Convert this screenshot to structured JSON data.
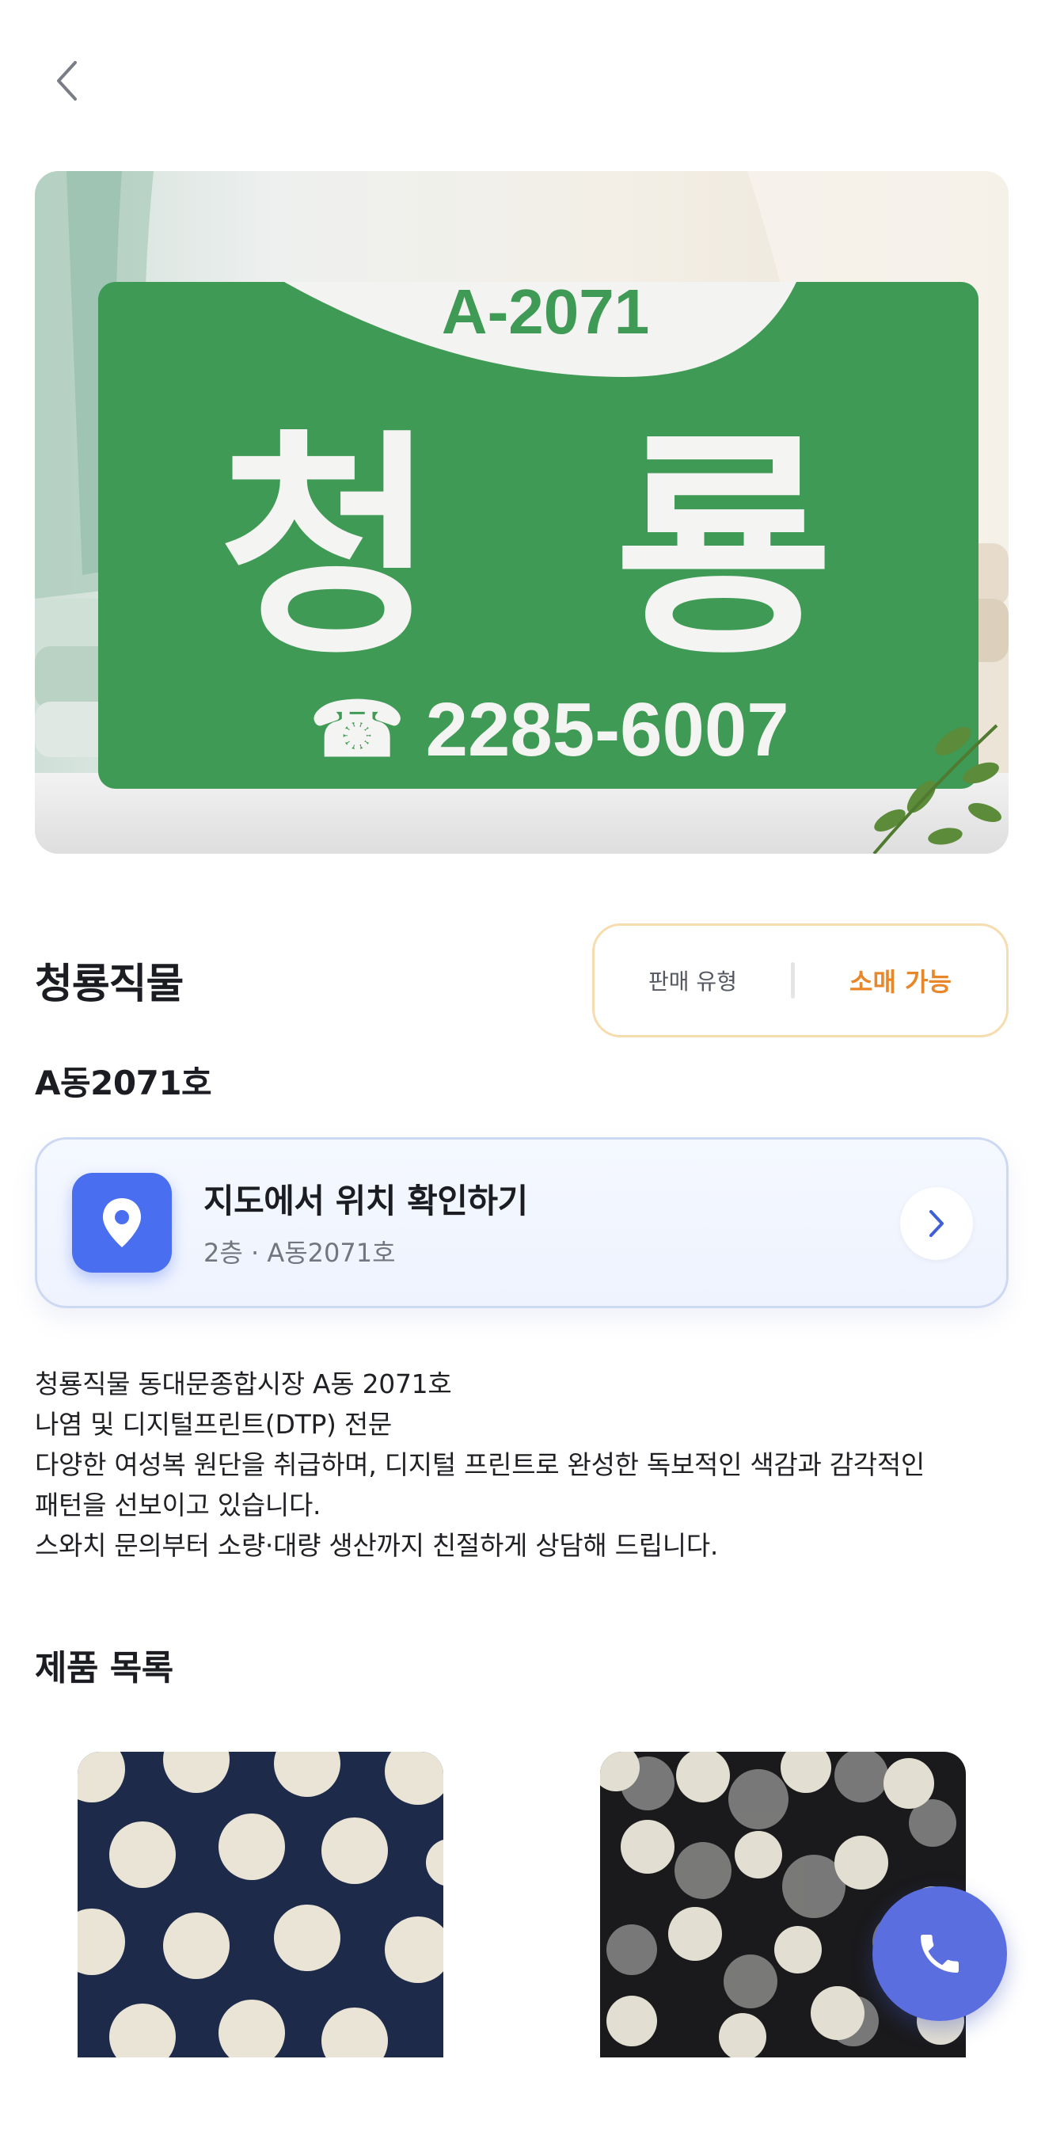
{
  "header": {
    "back_icon": "chevron-left-icon"
  },
  "hero": {
    "sign_unit": "A-2071",
    "sign_name": "청 룡",
    "sign_phone": "☎ 2285-6007",
    "sign_color": "#3f9a55"
  },
  "store": {
    "name": "청룡직물",
    "unit": "A동2071호",
    "sale_type_label": "판매 유형",
    "sale_type_value": "소매 가능",
    "accent_color": "#e8872a"
  },
  "map_card": {
    "title": "지도에서 위치 확인하기",
    "subtitle": "2층 · A동2071호",
    "pin_icon": "map-pin-icon",
    "arrow_icon": "chevron-right-icon",
    "pin_color": "#4a6ef0"
  },
  "description": [
    "청룡직물 동대문종합시장 A동 2071호",
    "나염 및 디지털프린트(DTP) 전문",
    "다양한 여성복 원단을 취급하며, 디지털 프린트로 완성한 독보적인 색감과 감각적인",
    "패턴을 선보이고 있습니다.",
    "스와치 문의부터 소량·대량 생산까지 친절하게 상담해 드립니다."
  ],
  "products": {
    "section_title": "제품 목록",
    "items": [
      {
        "pattern": "navy-polka-dot"
      },
      {
        "pattern": "black-bokeh-dot"
      }
    ]
  },
  "fab": {
    "icon": "phone-icon",
    "color": "#5b6ee0"
  }
}
